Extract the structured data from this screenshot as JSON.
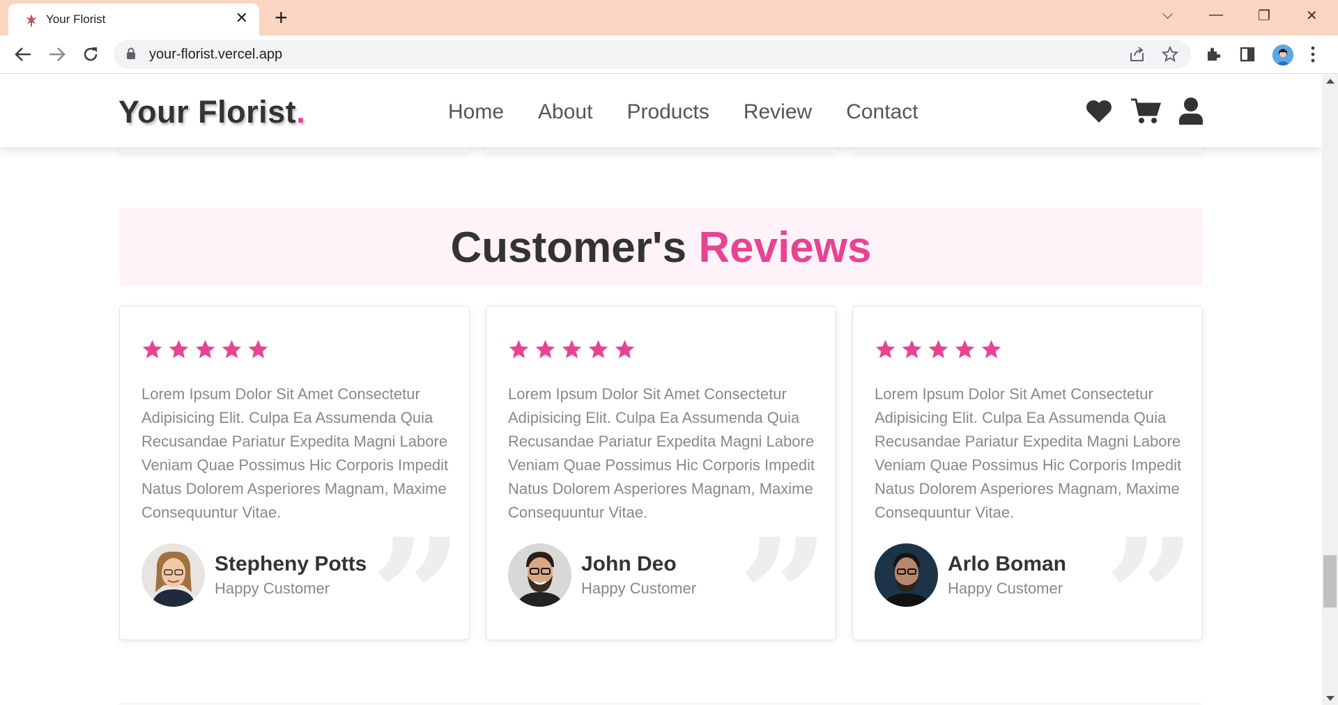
{
  "browser": {
    "tab_title": "Your Florist",
    "tab_close": "✕",
    "new_tab": "+",
    "url": "your-florist.vercel.app",
    "window_controls": {
      "dropdown": "⌵",
      "minimize": "—",
      "restore": "❐",
      "close": "✕"
    }
  },
  "site": {
    "logo_text": "Your Florist",
    "logo_dot": ".",
    "nav": [
      "Home",
      "About",
      "Products",
      "Review",
      "Contact"
    ],
    "header_icons": [
      "heart-icon",
      "cart-icon",
      "user-icon"
    ]
  },
  "section": {
    "heading_main": "Customer's",
    "heading_accent": "Reviews"
  },
  "reviews": [
    {
      "rating": 5,
      "text": "Lorem Ipsum Dolor Sit Amet Consectetur Adipisicing Elit. Culpa Ea Assumenda Quia Recusandae Pariatur Expedita Magni Labore Veniam Quae Possimus Hic Corporis Impedit Natus Dolorem Asperiores Magnam, Maxime Consequuntur Vitae.",
      "name": "Stepheny Potts",
      "role": "Happy Customer"
    },
    {
      "rating": 5,
      "text": "Lorem Ipsum Dolor Sit Amet Consectetur Adipisicing Elit. Culpa Ea Assumenda Quia Recusandae Pariatur Expedita Magni Labore Veniam Quae Possimus Hic Corporis Impedit Natus Dolorem Asperiores Magnam, Maxime Consequuntur Vitae.",
      "name": "John Deo",
      "role": "Happy Customer"
    },
    {
      "rating": 5,
      "text": "Lorem Ipsum Dolor Sit Amet Consectetur Adipisicing Elit. Culpa Ea Assumenda Quia Recusandae Pariatur Expedita Magni Labore Veniam Quae Possimus Hic Corporis Impedit Natus Dolorem Asperiores Magnam, Maxime Consequuntur Vitae.",
      "name": "Arlo Boman",
      "role": "Happy Customer"
    }
  ],
  "quote_glyph": "”",
  "colors": {
    "accent": "#e84393",
    "tabbar": "#fad5c2",
    "heading_band": "#fff2f8",
    "text_dark": "#333333",
    "text_muted": "#888888"
  }
}
